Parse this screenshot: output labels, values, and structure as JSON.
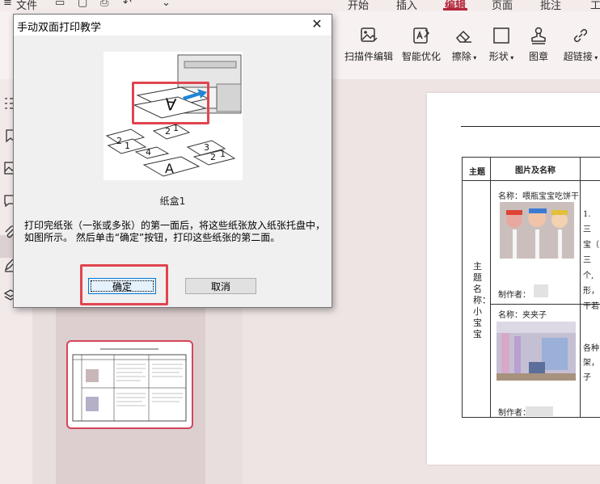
{
  "menu": {
    "file_label": "文件",
    "tabs": [
      "开始",
      "插入",
      "编辑",
      "页面",
      "批注"
    ]
  },
  "ribbon": {
    "items": [
      {
        "label": "扫描件编辑",
        "icon": "scan-edit-icon"
      },
      {
        "label": "智能优化",
        "icon": "smart-optimize-icon"
      },
      {
        "label": "擦除",
        "icon": "eraser-icon"
      },
      {
        "label": "形状",
        "icon": "shape-icon"
      },
      {
        "label": "图章",
        "icon": "stamp-icon"
      },
      {
        "label": "超链接",
        "icon": "hyperlink-icon"
      }
    ]
  },
  "dialog": {
    "title": "手动双面打印教学",
    "tray_label": "纸盒1",
    "instruction": "打印完纸张（一张或多张）的第一面后，将这些纸张放入纸张托盘中，如图所示。 然后单击“确定”按钮，打印这些纸张的第二面。",
    "ok_label": "确定",
    "cancel_label": "取消"
  },
  "document": {
    "col_theme": "主题",
    "col_picture": "图片及名称",
    "theme_value": "主题名称：小宝宝",
    "row1_name": "名称：喂瓶宝宝吃饼干",
    "row2_name": "名称：夹夹子",
    "maker_label": "制作者：",
    "right_col_lines_1": [
      "1. 三",
      "宝（",
      "三个,",
      "形，",
      "干若"
    ],
    "right_col_lines_2": [
      "各种",
      "架，",
      "子"
    ]
  },
  "colors": {
    "accent": "#b2263a",
    "highlight": "#e0454f"
  }
}
